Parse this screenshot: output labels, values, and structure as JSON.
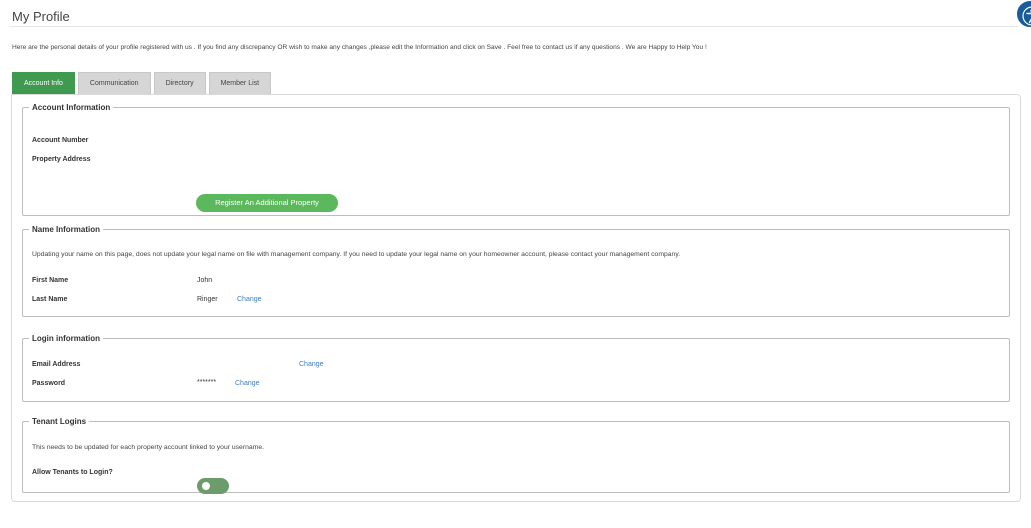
{
  "page": {
    "title": "My Profile",
    "intro": "Here are the personal details of your profile registered with us . If you find any discrepancy OR wish to make any changes ,please edit the Information and click on Save . Feel free to contact us if any questions . We are Happy to Help You !"
  },
  "accessibility": {
    "icon": "accessibility-icon",
    "color": "#1a5c9b"
  },
  "tabs": [
    {
      "label": "Account Info",
      "active": true
    },
    {
      "label": "Communication",
      "active": false
    },
    {
      "label": "Directory",
      "active": false
    },
    {
      "label": "Member List",
      "active": false
    }
  ],
  "account_info": {
    "legend": "Account Information",
    "account_number_label": "Account Number",
    "property_address_label": "Property Address",
    "register_button": "Register An Additional Property"
  },
  "name_info": {
    "legend": "Name Information",
    "note": "Updating your name on this page, does not update your legal name on file with management company. If you need to update your legal name on your homeowner account, please contact your management company.",
    "first_name_label": "First Name",
    "first_name_value": "John",
    "last_name_label": "Last Name",
    "last_name_value": "Ringer",
    "change_label": "Change"
  },
  "login_info": {
    "legend": "Login information",
    "email_label": "Email Address",
    "email_change": "Change",
    "password_label": "Password",
    "password_value": "*******",
    "password_change": "Change"
  },
  "tenant_logins": {
    "legend": "Tenant Logins",
    "note": "This needs to be updated for each property account linked to your username.",
    "allow_label": "Allow Tenants to Login?",
    "toggle_on": false
  },
  "colors": {
    "accent_green": "#3f9a4f",
    "button_green": "#5cb85c",
    "link_blue": "#3a7fc1"
  }
}
